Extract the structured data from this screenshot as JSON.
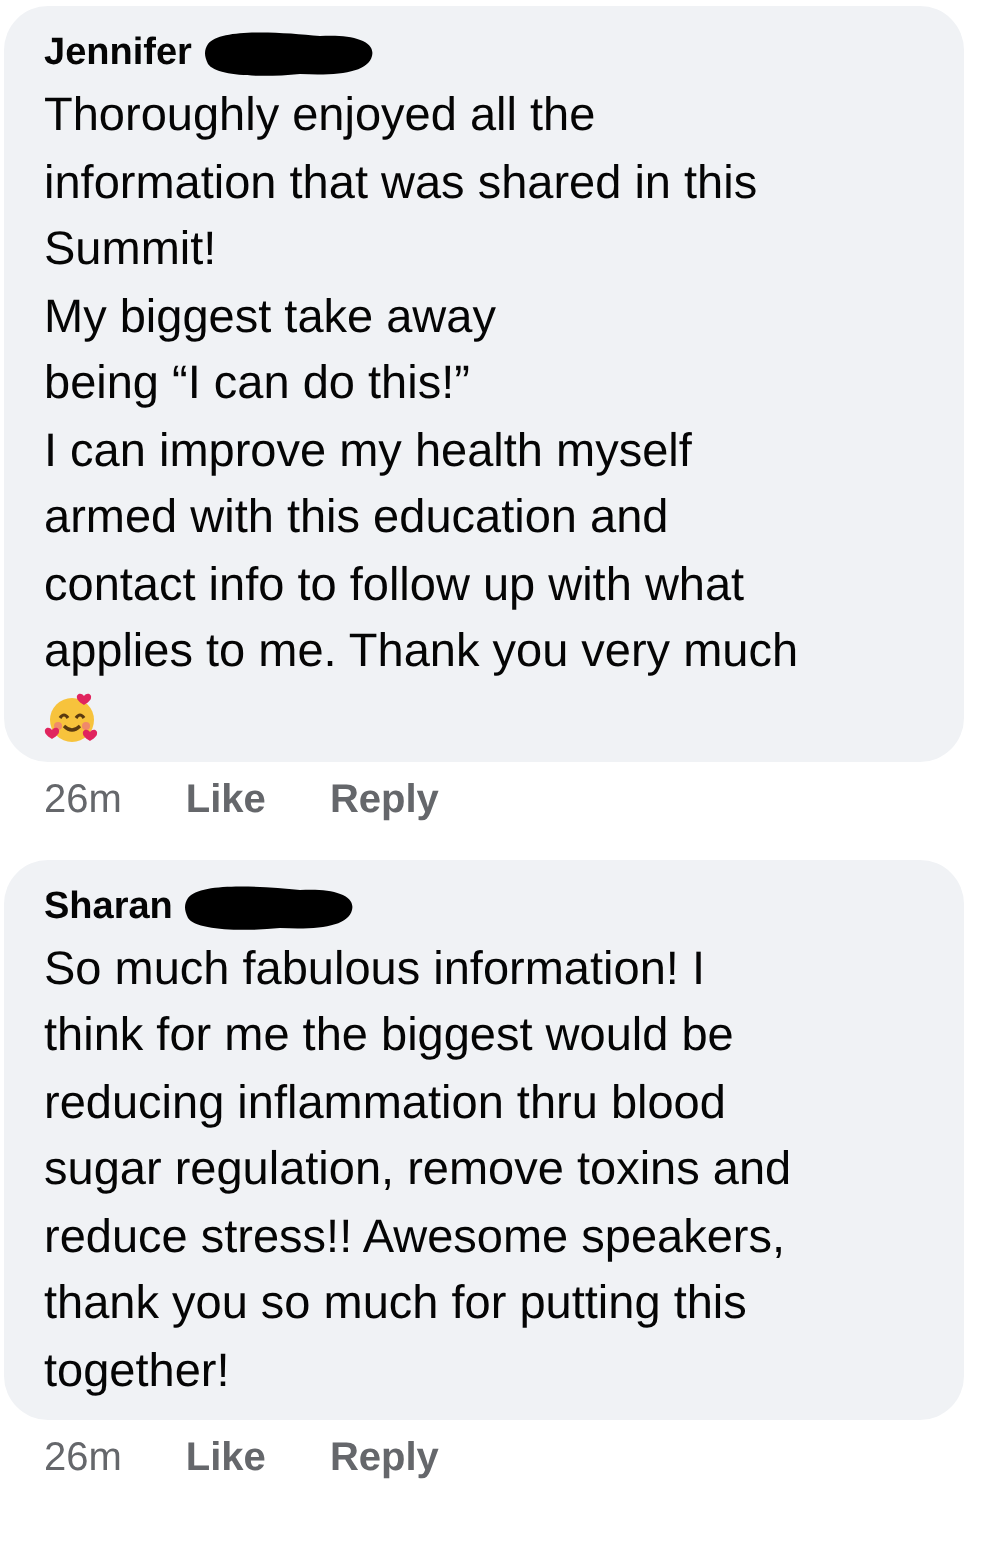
{
  "comments": [
    {
      "author": "Jennifer",
      "name_redacted": true,
      "text": "Thoroughly enjoyed all the\ninformation that was shared in this\nSummit!\nMy biggest take away\nbeing “I can do this!”\nI can improve my health myself\narmed with this education and\ncontact info to follow up with what\napplies to me. Thank you very much",
      "has_emoji": true,
      "time": "26m",
      "like": "Like",
      "reply": "Reply"
    },
    {
      "author": "Sharan",
      "name_redacted": true,
      "text": "So much fabulous information! I\nthink for me the biggest would be\nreducing inflammation thru blood\nsugar regulation, remove toxins and\nreduce stress!! Awesome speakers,\nthank you so much for putting this\ntogether!",
      "has_emoji": false,
      "time": "26m",
      "like": "Like",
      "reply": "Reply"
    }
  ]
}
